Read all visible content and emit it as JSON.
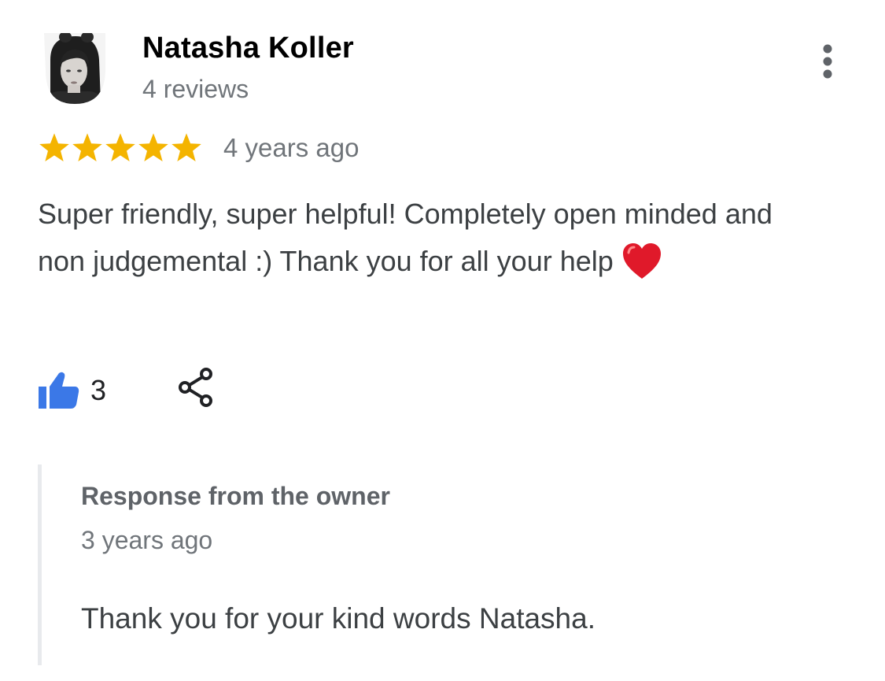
{
  "review": {
    "author": {
      "name": "Natasha Koller",
      "review_count": "4 reviews",
      "avatar_icon": "profile-photo"
    },
    "rating": {
      "stars": 5,
      "max": 5,
      "star_color": "#f4b400"
    },
    "date": "4 years ago",
    "text": "Super friendly, super helpful! Completely open minded and non judgemental :) Thank you for all your help",
    "emoji": "red-heart",
    "likes": {
      "count": "3",
      "icon": "thumbs-up-icon",
      "color": "#3b78e7"
    },
    "share_icon": "share-icon",
    "menu_icon": "more-vert-icon"
  },
  "owner_response": {
    "title": "Response from the owner",
    "date": "3 years ago",
    "text": "Thank you for your kind words Natasha."
  }
}
